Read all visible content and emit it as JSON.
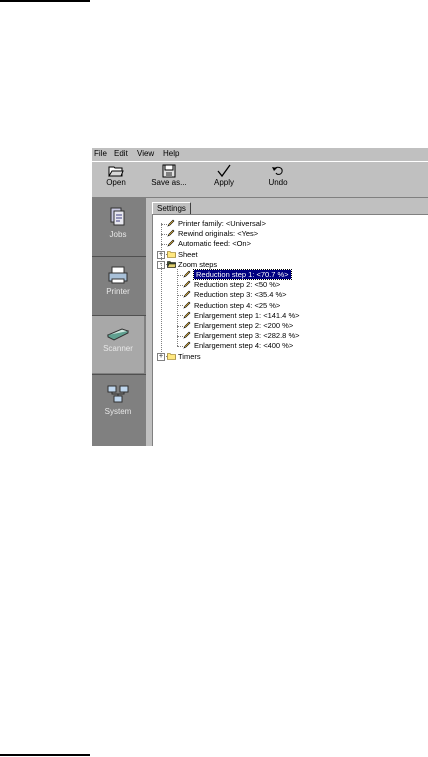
{
  "menu": [
    "File",
    "Edit",
    "View",
    "Help"
  ],
  "toolbar": [
    {
      "label": "Open",
      "icon": "open-folder-icon"
    },
    {
      "label": "Save as...",
      "icon": "floppy-disk-icon"
    },
    {
      "label": "Apply",
      "icon": "checkmark-icon"
    },
    {
      "label": "Undo",
      "icon": "undo-icon"
    }
  ],
  "sidebar": [
    {
      "label": "Jobs",
      "icon": "jobs-icon",
      "selected": false
    },
    {
      "label": "Printer",
      "icon": "printer-icon",
      "selected": false
    },
    {
      "label": "Scanner",
      "icon": "scanner-icon",
      "selected": true
    },
    {
      "label": "System",
      "icon": "system-icon",
      "selected": false
    }
  ],
  "tab": "Settings",
  "tree": [
    {
      "label": "Printer family: <Universal>",
      "type": "setting"
    },
    {
      "label": "Rewind originals: <Yes>",
      "type": "setting"
    },
    {
      "label": "Automatic feed: <On>",
      "type": "setting"
    },
    {
      "label": "Sheet",
      "type": "folder",
      "expander": "+"
    },
    {
      "label": "Zoom steps",
      "type": "folder-open",
      "expander": "-"
    },
    {
      "label": "Reduction step 1: <70.7 %>",
      "type": "setting",
      "selected": true
    },
    {
      "label": "Reduction step 2: <50 %>",
      "type": "setting"
    },
    {
      "label": "Reduction step 3: <35.4 %>",
      "type": "setting"
    },
    {
      "label": "Reduction step 4: <25 %>",
      "type": "setting"
    },
    {
      "label": "Enlargement step 1: <141.4 %>",
      "type": "setting"
    },
    {
      "label": "Enlargement step 2: <200 %>",
      "type": "setting"
    },
    {
      "label": "Enlargement step 3: <282.8 %>",
      "type": "setting"
    },
    {
      "label": "Enlargement step 4: <400 %>",
      "type": "setting"
    },
    {
      "label": "Timers",
      "type": "folder",
      "expander": "+"
    }
  ]
}
